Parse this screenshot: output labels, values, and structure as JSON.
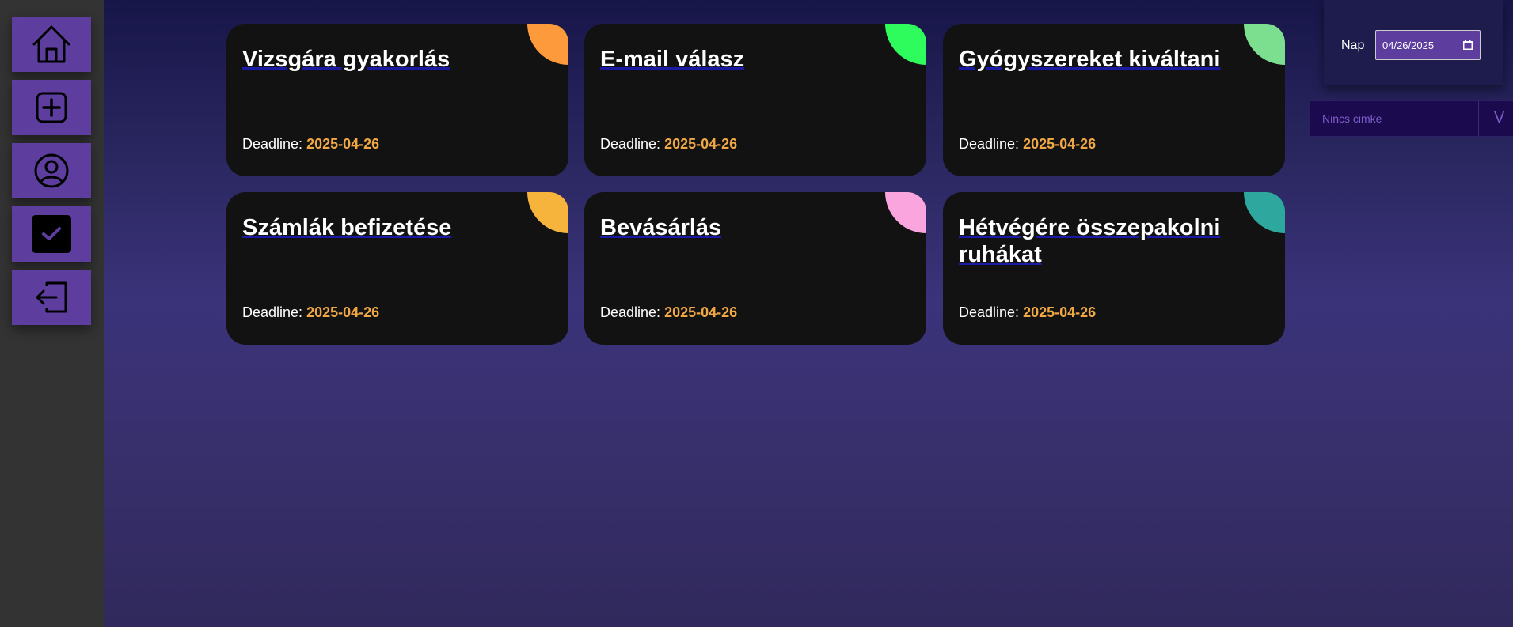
{
  "sidebar": {
    "items": [
      {
        "icon": "home-icon"
      },
      {
        "icon": "add-square-icon"
      },
      {
        "icon": "user-circle-icon"
      },
      {
        "icon": "checkbox-checked-icon"
      },
      {
        "icon": "logout-icon"
      }
    ],
    "button_color": "#5d3e9f"
  },
  "tasks": [
    {
      "title": "Vizsgára gyakorlás",
      "deadline_label": "Deadline:",
      "deadline": "2025-04-26",
      "color": "#fd9a3c"
    },
    {
      "title": "E-mail válasz",
      "deadline_label": "Deadline:",
      "deadline": "2025-04-26",
      "color": "#2dfc5c"
    },
    {
      "title": "Gyógyszereket kiváltani",
      "deadline_label": "Deadline:",
      "deadline": "2025-04-26",
      "color": "#7cdf90"
    },
    {
      "title": "Számlák befizetése",
      "deadline_label": "Deadline:",
      "deadline": "2025-04-26",
      "color": "#f7b43c"
    },
    {
      "title": "Bevásárlás",
      "deadline_label": "Deadline:",
      "deadline": "2025-04-26",
      "color": "#fba5df"
    },
    {
      "title": "Hétvégére összepakolni ruhákat",
      "deadline_label": "Deadline:",
      "deadline": "2025-04-26",
      "color": "#2ea89e"
    }
  ],
  "filter": {
    "day_label": "Nap",
    "date_value": "04/26/2025",
    "tag_placeholder": "Nincs cimke",
    "tag_chevron": "V"
  },
  "colors": {
    "deadline_value": "#f0a845",
    "card_bg": "#121212",
    "sidebar_bg": "#333333"
  }
}
